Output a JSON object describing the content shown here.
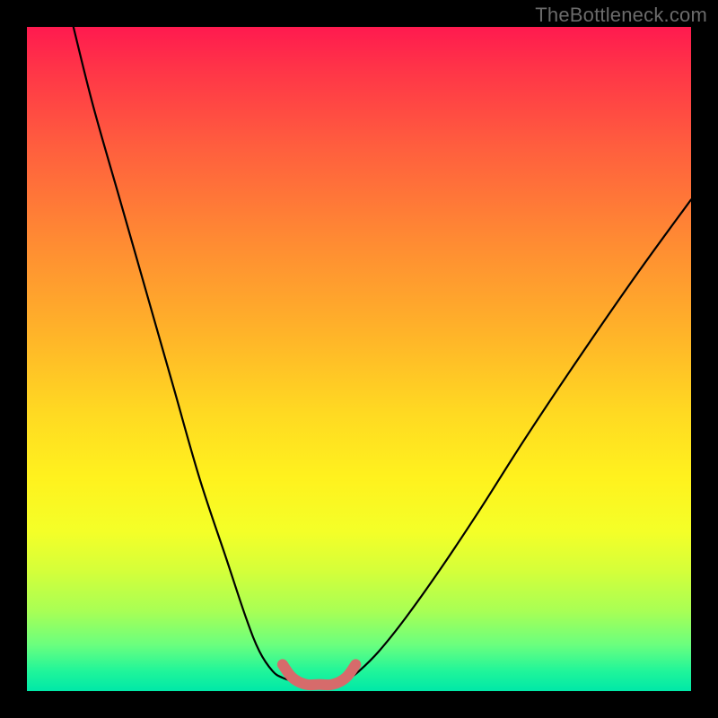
{
  "watermark": "TheBottleneck.com",
  "chart_data": {
    "type": "line",
    "title": "",
    "xlabel": "",
    "ylabel": "",
    "xlim": [
      0,
      100
    ],
    "ylim": [
      0,
      100
    ],
    "series": [
      {
        "name": "left-curve",
        "x": [
          7,
          10,
          14,
          18,
          22,
          26,
          30,
          33,
          35,
          37,
          38.5,
          40
        ],
        "y": [
          100,
          88,
          74,
          60,
          46,
          32,
          20,
          11,
          6,
          3,
          2,
          1.5
        ]
      },
      {
        "name": "valley-highlight",
        "x": [
          38.5,
          40,
          42,
          44,
          46,
          48,
          49.5
        ],
        "y": [
          4,
          2,
          1,
          1,
          1,
          2,
          4
        ]
      },
      {
        "name": "right-curve",
        "x": [
          48,
          50,
          53,
          57,
          62,
          68,
          75,
          83,
          92,
          100
        ],
        "y": [
          1.5,
          3,
          6,
          11,
          18,
          27,
          38,
          50,
          63,
          74
        ]
      }
    ],
    "colors": {
      "curve": "#000000",
      "highlight": "#d66b6b"
    }
  }
}
